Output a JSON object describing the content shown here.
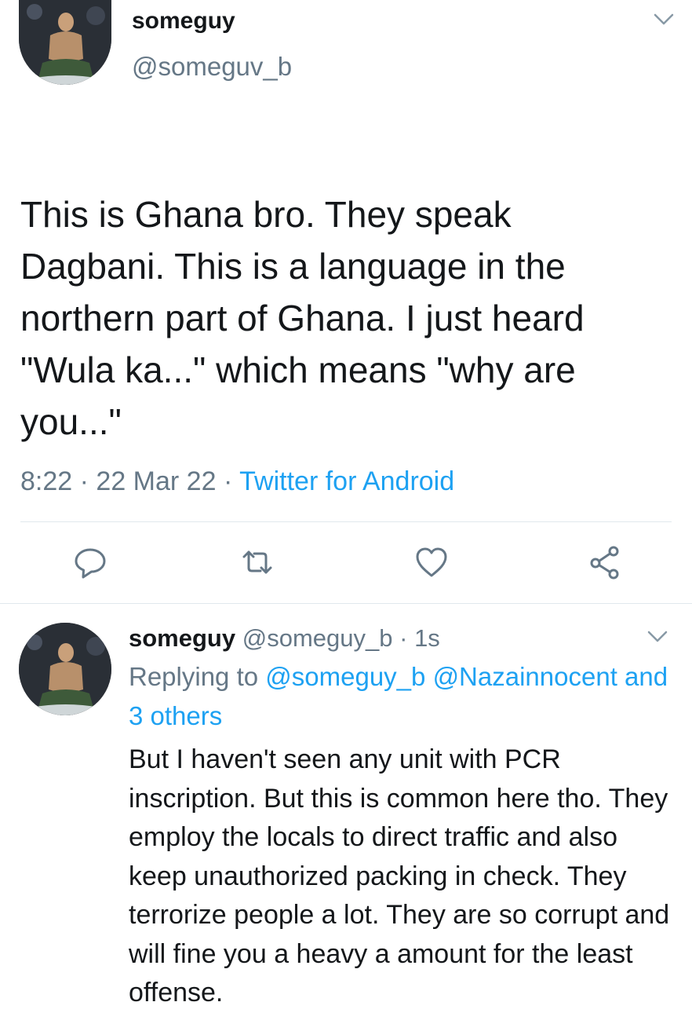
{
  "main_tweet": {
    "display_name": "someguy",
    "handle": "@someguv_b",
    "text": "This is Ghana bro. They speak Dagbani. This is a language in the northern part of Ghana. I just heard \"Wula ka...\" which means \"why are you...\"",
    "time": "8:22",
    "date": "22 Mar 22",
    "source": "Twitter for Android",
    "sep": "·",
    "actions": [
      "reply-icon",
      "retweet-icon",
      "like-icon",
      "share-icon"
    ]
  },
  "reply_tweet": {
    "display_name": "someguy",
    "handle": "@someguy_b",
    "sep": "·",
    "age": "1s",
    "replying_prefix": "Replying to",
    "replying_users": [
      "@someguy_b",
      "@Nazainnocent"
    ],
    "replying_more": "and 3 others",
    "text": "But I haven't seen any unit with PCR inscription. But this is common here tho. They employ the locals to direct traffic and also keep unauthorized packing in check. They terrorize people a lot. They are so corrupt and will fine you a heavy a amount for the least offense."
  },
  "colors": {
    "text_primary": "#14171a",
    "text_secondary": "#657786",
    "link": "#1da1f2",
    "divider": "#e1e8ed"
  }
}
